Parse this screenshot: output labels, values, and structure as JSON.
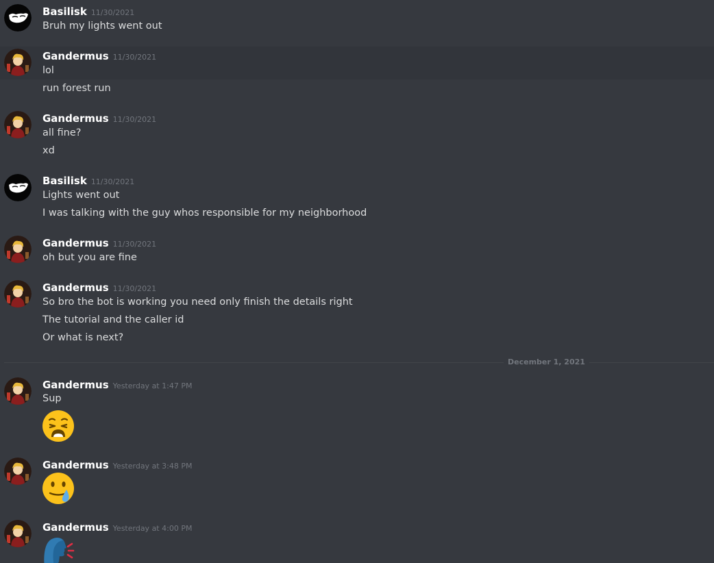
{
  "messages": [
    {
      "author": "Basilisk",
      "timestamp": "11/30/2021",
      "lines": [
        "Bruh my lights went out"
      ]
    },
    {
      "author": "Gandermus",
      "timestamp": "11/30/2021",
      "lines": [
        "lol",
        "run forest run"
      ]
    },
    {
      "author": "Gandermus",
      "timestamp": "11/30/2021",
      "lines": [
        "all fine?",
        "xd"
      ]
    },
    {
      "author": "Basilisk",
      "timestamp": "11/30/2021",
      "lines": [
        "Lights went out",
        "I was talking with the guy whos responsible for my neighborhood"
      ]
    },
    {
      "author": "Gandermus",
      "timestamp": "11/30/2021",
      "lines": [
        "oh but you are fine"
      ]
    },
    {
      "author": "Gandermus",
      "timestamp": "11/30/2021",
      "lines": [
        "So bro the bot is working you need only finish the details right",
        "The tutorial and the caller id",
        "Or what is next?"
      ]
    },
    {
      "author": "Gandermus",
      "timestamp": "Yesterday at 1:47 PM",
      "lines": [
        "Sup"
      ],
      "emoji": "weary-face-emoji"
    },
    {
      "author": "Gandermus",
      "timestamp": "Yesterday at 3:48 PM",
      "emoji": "face-holding-back-tears-emoji"
    },
    {
      "author": "Gandermus",
      "timestamp": "Yesterday at 4:00 PM",
      "emoji": "speaking-head-emoji"
    }
  ],
  "divider": {
    "label": "December 1, 2021"
  },
  "colors": {
    "background": "#36393f",
    "hover_row": "#32353b",
    "author": "#ffffff",
    "text": "#dcddde",
    "timestamp": "#72767d"
  }
}
